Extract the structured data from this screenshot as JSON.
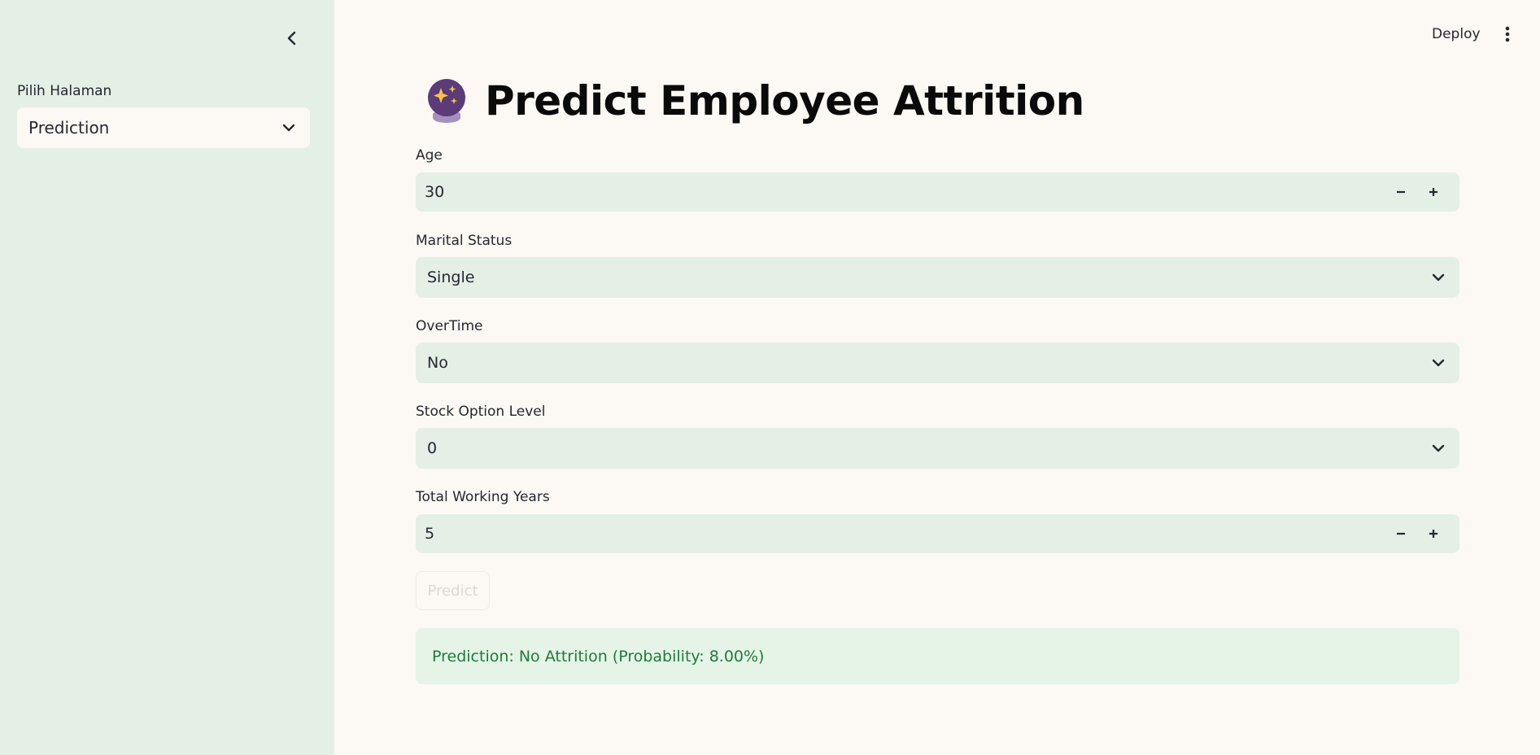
{
  "sidebar": {
    "page_select_label": "Pilih Halaman",
    "page_select_value": "Prediction"
  },
  "header": {
    "deploy_label": "Deploy"
  },
  "main": {
    "title_icon": "crystal-ball-icon",
    "title": "Predict Employee Attrition",
    "age": {
      "label": "Age",
      "value": "30"
    },
    "marital_status": {
      "label": "Marital Status",
      "value": "Single"
    },
    "overtime": {
      "label": "OverTime",
      "value": "No"
    },
    "stock_option_level": {
      "label": "Stock Option Level",
      "value": "0"
    },
    "total_working_years": {
      "label": "Total Working Years",
      "value": "5"
    },
    "predict_button": "Predict",
    "result": "Prediction: No Attrition (Probability: 8.00%)"
  },
  "colors": {
    "sidebar_bg": "#e4efe6",
    "main_bg": "#fcf9f4",
    "success_bg": "#e5f4e6",
    "success_text": "#1c7c3a"
  }
}
